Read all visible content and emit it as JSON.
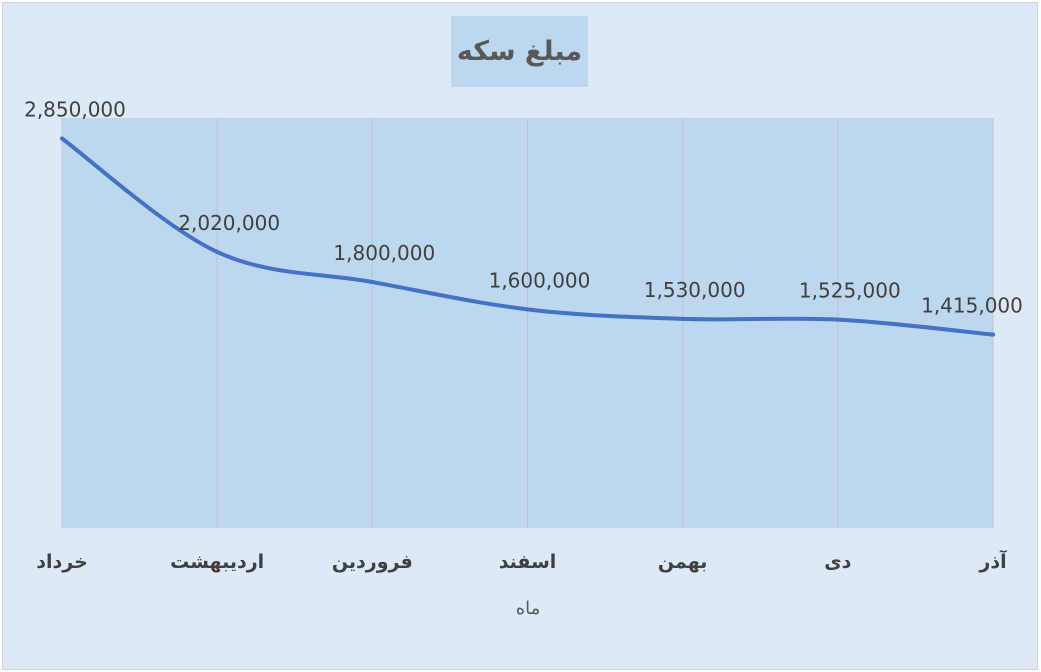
{
  "chart_data": {
    "type": "line",
    "title": "مبلغ سکه",
    "xlabel": "ماه",
    "ylabel": "",
    "categories": [
      "خرداد",
      "اردیبهشت",
      "فروردین",
      "اسفند",
      "بهمن",
      "دی",
      "آذر"
    ],
    "series": [
      {
        "values": [
          2850000,
          2020000,
          1800000,
          1600000,
          1530000,
          1525000,
          1415000
        ],
        "labels": [
          "2,850,000",
          "2,020,000",
          "1,800,000",
          "1,600,000",
          "1,530,000",
          "1,525,000",
          "1,415,000"
        ]
      }
    ],
    "ylim": [
      0,
      3000000
    ],
    "grid": "vertical",
    "smooth": true,
    "colors": {
      "line": "#4472c4",
      "plot_area": "#bdd7ee",
      "chart_area": "#dde9f6",
      "gridline": "#b7c6d8",
      "text": "#595959",
      "label": "#404040"
    }
  }
}
